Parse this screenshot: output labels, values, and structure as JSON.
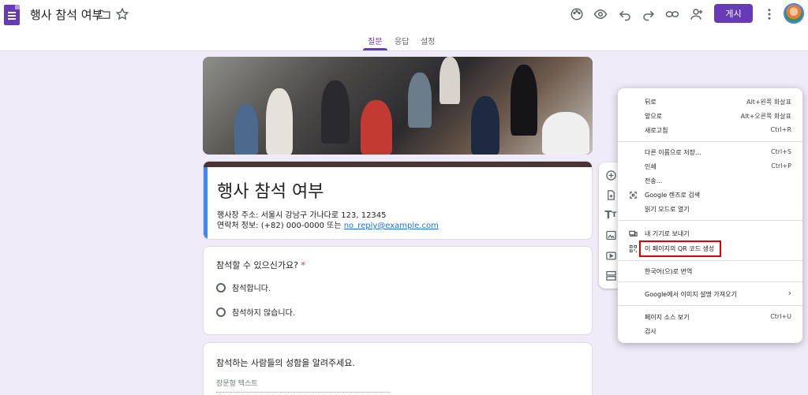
{
  "header": {
    "title": "행사 참석 여부",
    "publish_label": "게시"
  },
  "tabs": [
    {
      "label": "질문"
    },
    {
      "label": "응답"
    },
    {
      "label": "설정"
    }
  ],
  "form": {
    "title": "행사 참석 여부",
    "address": "행사장 주소: 서울시 강남구 가나다로 123, 12345",
    "contact_prefix": "연락처 정보: (+82) 000-0000 또는 ",
    "contact_email": "no_reply@example.com"
  },
  "question1": {
    "title": "참석할 수 있으신가요?",
    "required_mark": "*",
    "options": [
      "참석합니다.",
      "참석하지 않습니다."
    ]
  },
  "question2": {
    "title": "참석하는 사람들의 성함을 알려주세요.",
    "placeholder": "장문형 텍스트"
  },
  "context_menu": {
    "items": [
      {
        "label": "뒤로",
        "shortcut": "Alt+왼쪽 화살표"
      },
      {
        "label": "앞으로",
        "shortcut": "Alt+오른쪽 화살표"
      },
      {
        "label": "새로고침",
        "shortcut": "Ctrl+R"
      },
      {
        "label": "다른 이름으로 저장...",
        "shortcut": "Ctrl+S"
      },
      {
        "label": "인쇄",
        "shortcut": "Ctrl+P"
      },
      {
        "label": "전송...",
        "shortcut": ""
      },
      {
        "label": "Google 렌즈로 검색",
        "shortcut": "",
        "icon": "lens-icon"
      },
      {
        "label": "읽기 모드로 열기",
        "shortcut": ""
      },
      {
        "label": "내 기기로 보내기",
        "shortcut": "",
        "icon": "devices-icon"
      },
      {
        "label": "이 페이지의 QR 코드 생성",
        "shortcut": "",
        "icon": "qr-code-icon"
      },
      {
        "label": "한국어(으)로 번역",
        "shortcut": ""
      },
      {
        "label": "Google에서 이미지 설명 가져오기",
        "shortcut": "›"
      },
      {
        "label": "페이지 소스 보기",
        "shortcut": "Ctrl+U"
      },
      {
        "label": "검사",
        "shortcut": ""
      }
    ]
  },
  "colors": {
    "accent": "#673ab7",
    "background": "#f0ebf8",
    "highlight": "#e00000",
    "link": "#1a73e8"
  }
}
